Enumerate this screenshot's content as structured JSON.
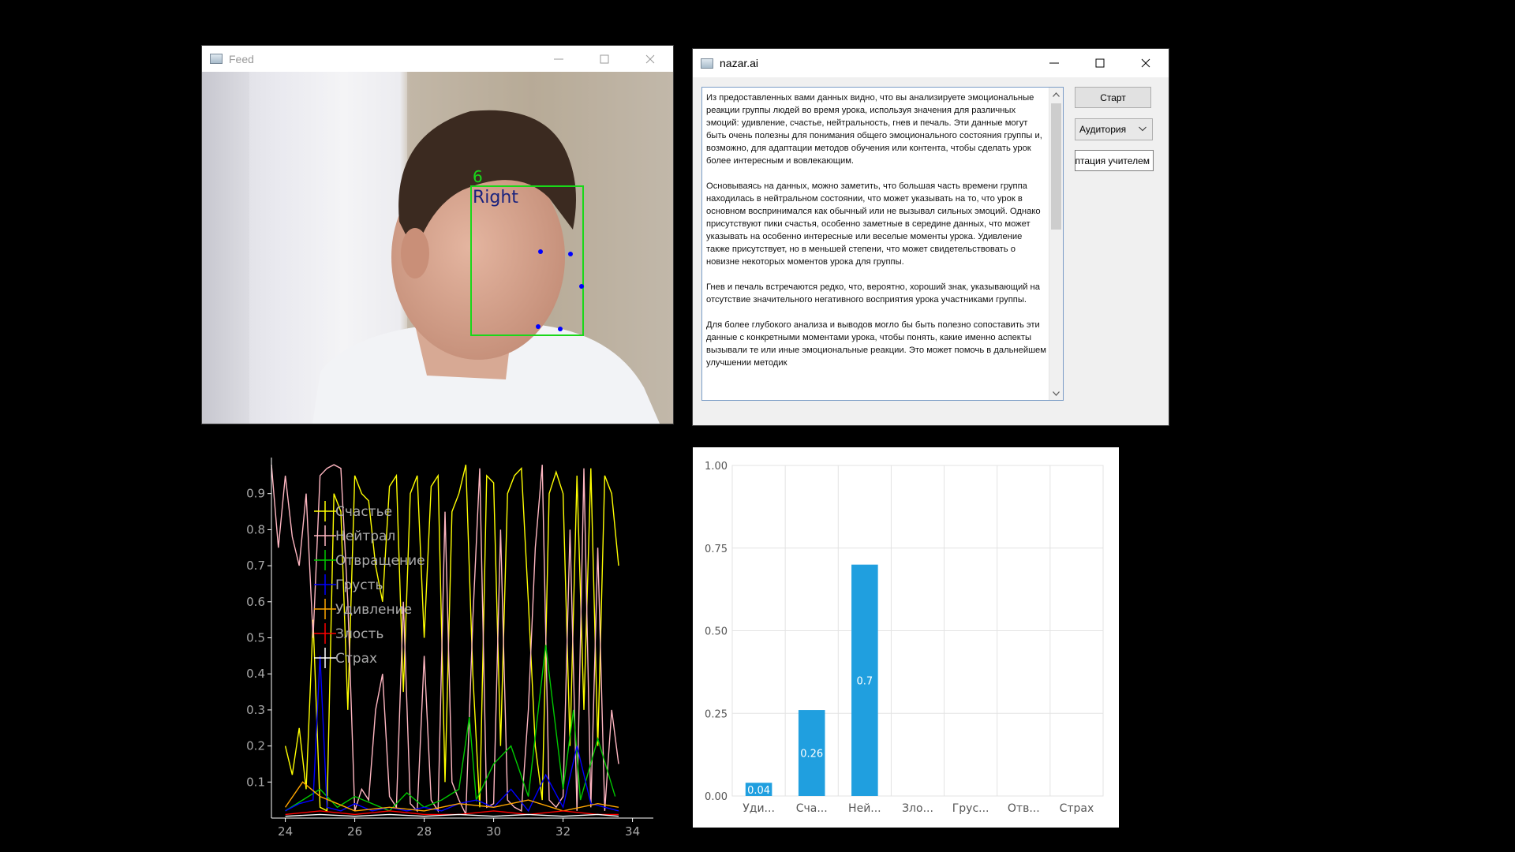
{
  "feed": {
    "title": "Feed",
    "overlay": {
      "count": "6",
      "direction": "Right"
    }
  },
  "nazar": {
    "title": "nazar.ai",
    "output_paragraphs": [
      "Из предоставленных вами данных видно, что вы анализируете эмоциональные реакции группы людей во время урока, используя значения для различных эмоций: удивление, счастье, нейтральность, гнев и печаль. Эти данные могут быть очень полезны для понимания общего эмоционального состояния группы и, возможно, для адаптации методов обучения или контента, чтобы сделать урок более интересным и вовлекающим.",
      "Основываясь на данных, можно заметить, что большая часть времени группа находилась в нейтральном состоянии, что может указывать на то, что урок в основном воспринимался как обычный или не вызывал сильных эмоций. Однако присутствуют пики счастья, особенно заметные в середине данных, что может указывать на особенно интересные или веселые моменты урока. Удивление также присутствует, но в меньшей степени, что может свидетельствовать о новизне некоторых моментов урока для группы.",
      "Гнев и печаль встречаются редко, что, вероятно, хороший знак, указывающий на отсутствие значительного негативного восприятия урока участниками группы.",
      "Для более глубокого анализа и выводов могло бы быть полезно сопоставить эти данные с конкретными моментами урока, чтобы понять, какие именно аспекты вызывали те или иные эмоциональные реакции. Это может помочь в дальнейшем улучшении методик"
    ],
    "start_label": "Старт",
    "audience_selected": "Аудитория",
    "adapt_label": "Адаптация учителем"
  },
  "colors": {
    "happiness": "#ffff00",
    "neutral": "#ffb6c1",
    "disgust": "#00c800",
    "sadness": "#0000ff",
    "surprise": "#ffa500",
    "anger": "#ff0000",
    "fear": "#ffffff",
    "bar": "#209fdf",
    "face_box": "#19d819"
  },
  "chart_data": [
    {
      "type": "line",
      "xticks": [
        "24",
        "26",
        "28",
        "30",
        "32",
        "34"
      ],
      "yticks": [
        "0.1",
        "0.2",
        "0.3",
        "0.4",
        "0.5",
        "0.6",
        "0.7",
        "0.8",
        "0.9"
      ],
      "xlim": [
        23.6,
        34.6
      ],
      "ylim": [
        0,
        1.0
      ],
      "legend": [
        "Счастье",
        "Нейтрал",
        "Отвращение",
        "Грусть",
        "Удивление",
        "Злость",
        "Страх"
      ],
      "legend_position": "upper-left",
      "series": [
        {
          "name": "Счастье",
          "x": [
            24.0,
            24.2,
            24.4,
            24.6,
            24.8,
            25.0,
            25.2,
            25.4,
            25.6,
            25.8,
            26.0,
            26.2,
            26.4,
            26.6,
            26.8,
            27.0,
            27.2,
            27.4,
            27.6,
            27.8,
            28.0,
            28.2,
            28.4,
            28.6,
            28.8,
            29.0,
            29.2,
            29.4,
            29.6,
            29.8,
            30.0,
            30.2,
            30.4,
            30.6,
            30.8,
            31.0,
            31.2,
            31.4,
            31.6,
            31.8,
            32.0,
            32.2,
            32.4,
            32.6,
            32.8,
            33.0,
            33.2,
            33.4,
            33.6
          ],
          "y": [
            0.2,
            0.12,
            0.25,
            0.08,
            0.55,
            0.03,
            0.02,
            0.9,
            0.85,
            0.3,
            0.95,
            0.9,
            0.88,
            0.7,
            0.6,
            0.92,
            0.95,
            0.35,
            0.9,
            0.95,
            0.5,
            0.92,
            0.95,
            0.1,
            0.85,
            0.9,
            0.98,
            0.4,
            0.03,
            0.95,
            0.93,
            0.2,
            0.9,
            0.95,
            0.97,
            0.6,
            0.2,
            0.05,
            0.9,
            0.96,
            0.9,
            0.2,
            0.95,
            0.3,
            0.97,
            0.2,
            0.95,
            0.9,
            0.7
          ]
        },
        {
          "name": "Нейтрал",
          "x": [
            23.6,
            23.8,
            24.0,
            24.2,
            24.4,
            24.6,
            24.8,
            25.0,
            25.2,
            25.4,
            25.6,
            25.8,
            26.0,
            26.2,
            26.4,
            26.6,
            26.8,
            27.0,
            27.2,
            27.4,
            27.6,
            27.8,
            28.0,
            28.2,
            28.4,
            28.6,
            28.8,
            29.0,
            29.2,
            29.4,
            29.6,
            29.8,
            30.0,
            30.2,
            30.4,
            30.6,
            30.8,
            31.0,
            31.2,
            31.4,
            31.6,
            31.8,
            32.0,
            32.2,
            32.4,
            32.6,
            32.8,
            33.0,
            33.2,
            33.4,
            33.6
          ],
          "y": [
            0.98,
            0.75,
            0.95,
            0.78,
            0.7,
            0.9,
            0.5,
            0.95,
            0.97,
            0.98,
            0.97,
            0.6,
            0.02,
            0.08,
            0.05,
            0.3,
            0.4,
            0.06,
            0.03,
            0.6,
            0.04,
            0.02,
            0.45,
            0.05,
            0.02,
            0.85,
            0.1,
            0.05,
            0.01,
            0.55,
            0.97,
            0.03,
            0.04,
            0.8,
            0.05,
            0.03,
            0.02,
            0.3,
            0.75,
            0.98,
            0.05,
            0.03,
            0.06,
            0.8,
            0.02,
            0.97,
            0.03,
            0.75,
            0.02,
            0.3,
            0.15
          ]
        },
        {
          "name": "Отвращение",
          "x": [
            24.0,
            24.5,
            25.0,
            25.5,
            26.0,
            26.5,
            27.0,
            27.5,
            28.0,
            28.5,
            29.0,
            29.3,
            29.5,
            30.0,
            30.5,
            31.0,
            31.5,
            32.0,
            32.3,
            32.5,
            33.0,
            33.5
          ],
          "y": [
            0.02,
            0.05,
            0.08,
            0.03,
            0.06,
            0.04,
            0.02,
            0.07,
            0.03,
            0.05,
            0.08,
            0.28,
            0.05,
            0.15,
            0.2,
            0.06,
            0.48,
            0.08,
            0.3,
            0.05,
            0.22,
            0.06
          ]
        },
        {
          "name": "Грусть",
          "x": [
            24.0,
            24.4,
            24.8,
            25.0,
            25.2,
            25.6,
            26.0,
            26.5,
            27.0,
            27.5,
            28.0,
            28.5,
            29.0,
            29.5,
            30.0,
            30.5,
            31.0,
            31.5,
            32.0,
            32.4,
            32.8,
            33.2,
            33.6
          ],
          "y": [
            0.02,
            0.04,
            0.05,
            0.45,
            0.03,
            0.02,
            0.04,
            0.02,
            0.03,
            0.02,
            0.03,
            0.02,
            0.04,
            0.05,
            0.03,
            0.08,
            0.02,
            0.12,
            0.03,
            0.2,
            0.04,
            0.03,
            0.02
          ]
        },
        {
          "name": "Удивление",
          "x": [
            24.0,
            24.5,
            25.0,
            25.5,
            26.0,
            27.0,
            28.0,
            29.0,
            30.0,
            31.0,
            32.0,
            33.0,
            33.6
          ],
          "y": [
            0.03,
            0.1,
            0.06,
            0.04,
            0.02,
            0.03,
            0.02,
            0.04,
            0.03,
            0.05,
            0.02,
            0.04,
            0.03
          ]
        },
        {
          "name": "Злость",
          "x": [
            24.0,
            25.0,
            26.0,
            27.0,
            28.0,
            29.0,
            30.0,
            31.0,
            32.0,
            33.0,
            33.6
          ],
          "y": [
            0.01,
            0.02,
            0.01,
            0.02,
            0.01,
            0.01,
            0.02,
            0.01,
            0.02,
            0.01,
            0.01
          ]
        },
        {
          "name": "Страх",
          "x": [
            24.0,
            25.0,
            26.0,
            27.0,
            28.0,
            29.0,
            30.0,
            31.0,
            32.0,
            33.0,
            33.6
          ],
          "y": [
            0.005,
            0.01,
            0.005,
            0.01,
            0.005,
            0.01,
            0.005,
            0.01,
            0.005,
            0.01,
            0.005
          ]
        }
      ]
    },
    {
      "type": "bar",
      "categories": [
        "Уди...",
        "Сча...",
        "Ней...",
        "Зло...",
        "Грус...",
        "Отв...",
        "Страх"
      ],
      "values": [
        0.04,
        0.26,
        0.7,
        0,
        0,
        0,
        0
      ],
      "labels": [
        "0.04",
        "0.26",
        "0.7",
        "",
        "",
        "",
        ""
      ],
      "yticks": [
        "0.00",
        "0.25",
        "0.50",
        "0.75",
        "1.00"
      ],
      "ylim": [
        0,
        1.0
      ]
    }
  ]
}
